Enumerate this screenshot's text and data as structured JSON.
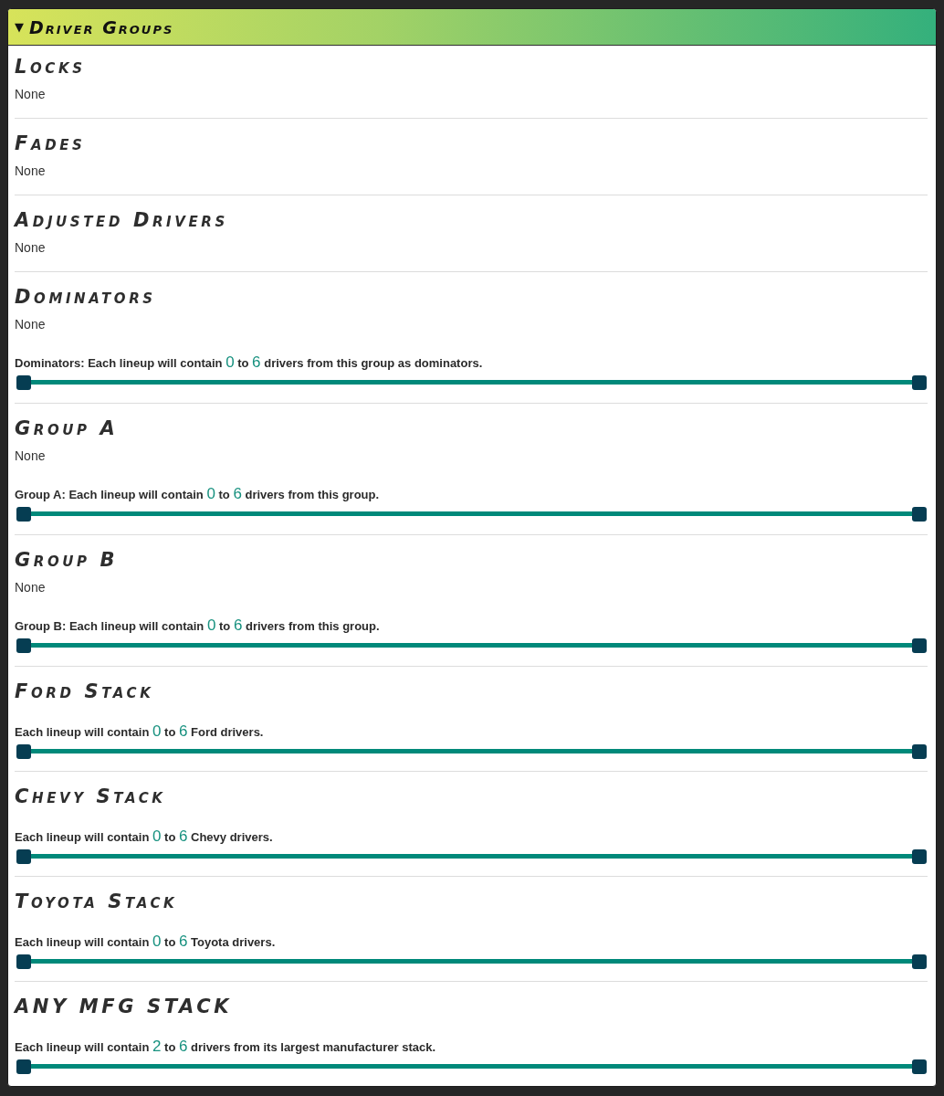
{
  "panel": {
    "header": {
      "toggle": "▼",
      "title": "Driver Groups",
      "expanded": true
    },
    "sections": [
      {
        "title": "Locks",
        "value": "None"
      },
      {
        "title": "Fades",
        "value": "None"
      },
      {
        "title": "Adjusted Drivers",
        "value": "None"
      },
      {
        "title": "Dominators",
        "value": "None",
        "range": {
          "before": "Dominators: Each lineup will contain",
          "min": "0",
          "between": "to",
          "max": "6",
          "after": "drivers from this group as dominators.",
          "thumbs": [
            {
              "level": 0
            },
            {
              "level": 1
            }
          ]
        }
      },
      {
        "title": "Group A",
        "value": "None",
        "range": {
          "before": "Group A: Each lineup will contain",
          "min": "0",
          "between": "to",
          "max": "6",
          "after": "drivers from this group.",
          "thumbs": [
            {
              "level": 0
            },
            {
              "level": 1
            }
          ]
        }
      },
      {
        "title": "Group B",
        "value": "None",
        "range": {
          "before": "Group B: Each lineup will contain",
          "min": "0",
          "between": "to",
          "max": "6",
          "after": "drivers from this group.",
          "thumbs": [
            {
              "level": 0
            },
            {
              "level": 1
            }
          ]
        }
      },
      {
        "title": "Ford Stack",
        "range": {
          "before": "Each lineup will contain",
          "min": "0",
          "between": "to",
          "max": "6",
          "after": "Ford drivers.",
          "thumbs": [
            {
              "level": 0
            },
            {
              "level": 1
            }
          ]
        }
      },
      {
        "title": "Chevy Stack",
        "range": {
          "before": "Each lineup will contain",
          "min": "0",
          "between": "to",
          "max": "6",
          "after": "Chevy drivers.",
          "thumbs": [
            {
              "level": 0
            },
            {
              "level": 1
            }
          ]
        }
      },
      {
        "title": "Toyota Stack",
        "range": {
          "before": "Each lineup will contain",
          "min": "0",
          "between": "to",
          "max": "6",
          "after": "Toyota drivers.",
          "thumbs": [
            {
              "level": 0
            },
            {
              "level": 1
            }
          ]
        }
      },
      {
        "title": "ANY MFG STACK",
        "range": {
          "before": "Each lineup will contain",
          "min": "2",
          "between": "to",
          "max": "6",
          "after": "drivers from its largest manufacturer stack.",
          "thumbs": [
            {
              "level": 0
            },
            {
              "level": 1
            }
          ]
        }
      }
    ]
  }
}
